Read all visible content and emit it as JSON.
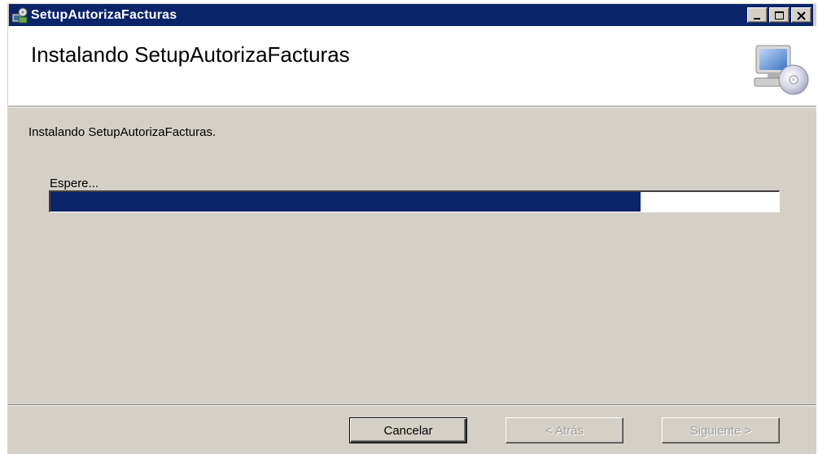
{
  "window": {
    "title": "SetupAutorizaFacturas",
    "app_icon": "installer-icon",
    "controls": {
      "minimize_icon": "minimize-icon",
      "maximize_icon": "maximize-icon",
      "close_icon": "close-icon"
    }
  },
  "header": {
    "title": "Instalando SetupAutorizaFacturas",
    "icon": "computer-cd-icon"
  },
  "body": {
    "status_text": "Instalando SetupAutorizaFacturas.",
    "wait_label": "Espere...",
    "progress_percent": 81
  },
  "buttons": {
    "cancel": "Cancelar",
    "back": "< Atrás",
    "next": "Siguiente >"
  },
  "colors": {
    "titlebar": "#0a246a",
    "progress_fill": "#0a246a",
    "dialog_face": "#d4d0c8"
  }
}
